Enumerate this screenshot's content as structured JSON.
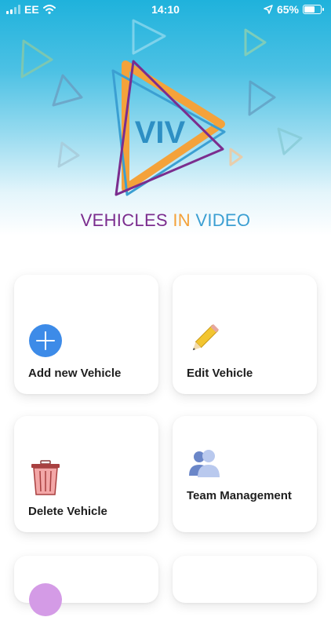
{
  "status_bar": {
    "carrier": "EE",
    "time": "14:10",
    "battery_percent": "65%",
    "battery_level": 0.65
  },
  "brand": {
    "logo_text": "VIV",
    "title_part1": "VEHICLES",
    "title_part2": "IN",
    "title_part3": "VIDEO",
    "colors": {
      "purple": "#7b2d8e",
      "orange": "#f4a23a",
      "blue": "#3b9fd2"
    }
  },
  "menu": [
    {
      "label": "Add new Vehicle",
      "icon": "add-circle-icon"
    },
    {
      "label": "Edit Vehicle",
      "icon": "pencil-icon"
    },
    {
      "label": "Delete Vehicle",
      "icon": "trash-icon"
    },
    {
      "label": "Team Management",
      "icon": "team-icon"
    },
    {
      "label": "",
      "icon": "purple-circle-icon"
    },
    {
      "label": "",
      "icon": ""
    }
  ]
}
